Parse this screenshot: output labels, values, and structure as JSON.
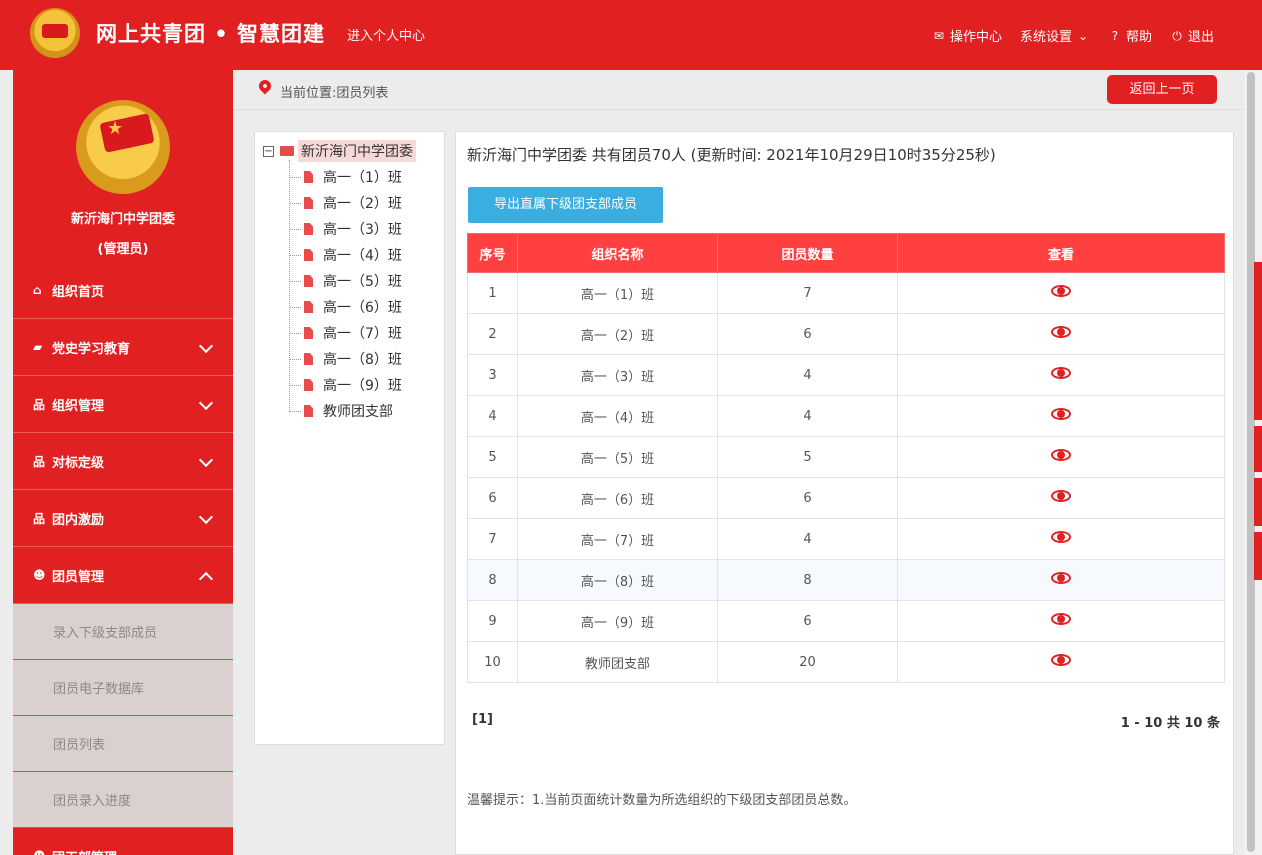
{
  "header": {
    "brand": "网上共青团 • 智慧团建",
    "personal_center": "进入个人中心",
    "nav": {
      "ops": "操作中心",
      "settings": "系统设置",
      "help": "帮助",
      "logout": "退出"
    }
  },
  "sidebar": {
    "org_name": "新沂海门中学团委",
    "org_role": "(管理员)",
    "menu": [
      {
        "label": "组织首页",
        "icon": "home-icon"
      },
      {
        "label": "党史学习教育",
        "icon": "folder-icon"
      },
      {
        "label": "组织管理",
        "icon": "sitemap-icon"
      },
      {
        "label": "对标定级",
        "icon": "sitemap-icon"
      },
      {
        "label": "团内激励",
        "icon": "sitemap-icon"
      },
      {
        "label": "团员管理",
        "icon": "users-icon"
      }
    ],
    "submenu": [
      "录入下级支部成员",
      "团员电子数据库",
      "团员列表",
      "团员录入进度"
    ],
    "next_menu": "团干部管理"
  },
  "breadcrumb": {
    "text": "当前位置:团员列表",
    "back": "返回上一页"
  },
  "tree": {
    "root": "新沂海门中学团委",
    "children": [
      "高一（1）班",
      "高一（2）班",
      "高一（3）班",
      "高一（4）班",
      "高一（5）班",
      "高一（6）班",
      "高一（7）班",
      "高一（8）班",
      "高一（9）班",
      "教师团支部"
    ]
  },
  "main": {
    "summary": "新沂海门中学团委 共有团员70人 (更新时间: 2021年10月29日10时35分25秒)",
    "export_button": "导出直属下级团支部成员",
    "table": {
      "headers": [
        "序号",
        "组织名称",
        "团员数量",
        "查看"
      ],
      "rows": [
        [
          "1",
          "高一（1）班",
          "7"
        ],
        [
          "2",
          "高一（2）班",
          "6"
        ],
        [
          "3",
          "高一（3）班",
          "4"
        ],
        [
          "4",
          "高一（4）班",
          "4"
        ],
        [
          "5",
          "高一（5）班",
          "5"
        ],
        [
          "6",
          "高一（6）班",
          "6"
        ],
        [
          "7",
          "高一（7）班",
          "4"
        ],
        [
          "8",
          "高一（8）班",
          "8"
        ],
        [
          "9",
          "高一（9）班",
          "6"
        ],
        [
          "10",
          "教师团支部",
          "20"
        ]
      ]
    },
    "pager_left": "[1]",
    "pager_right": "1 - 10 共 10 条",
    "tip": "温馨提示：1.当前页面统计数量为所选组织的下级团支部团员总数。"
  },
  "colors": {
    "brand_red": "#e12022",
    "table_header": "#ff4040",
    "export_blue": "#3aaee0"
  }
}
